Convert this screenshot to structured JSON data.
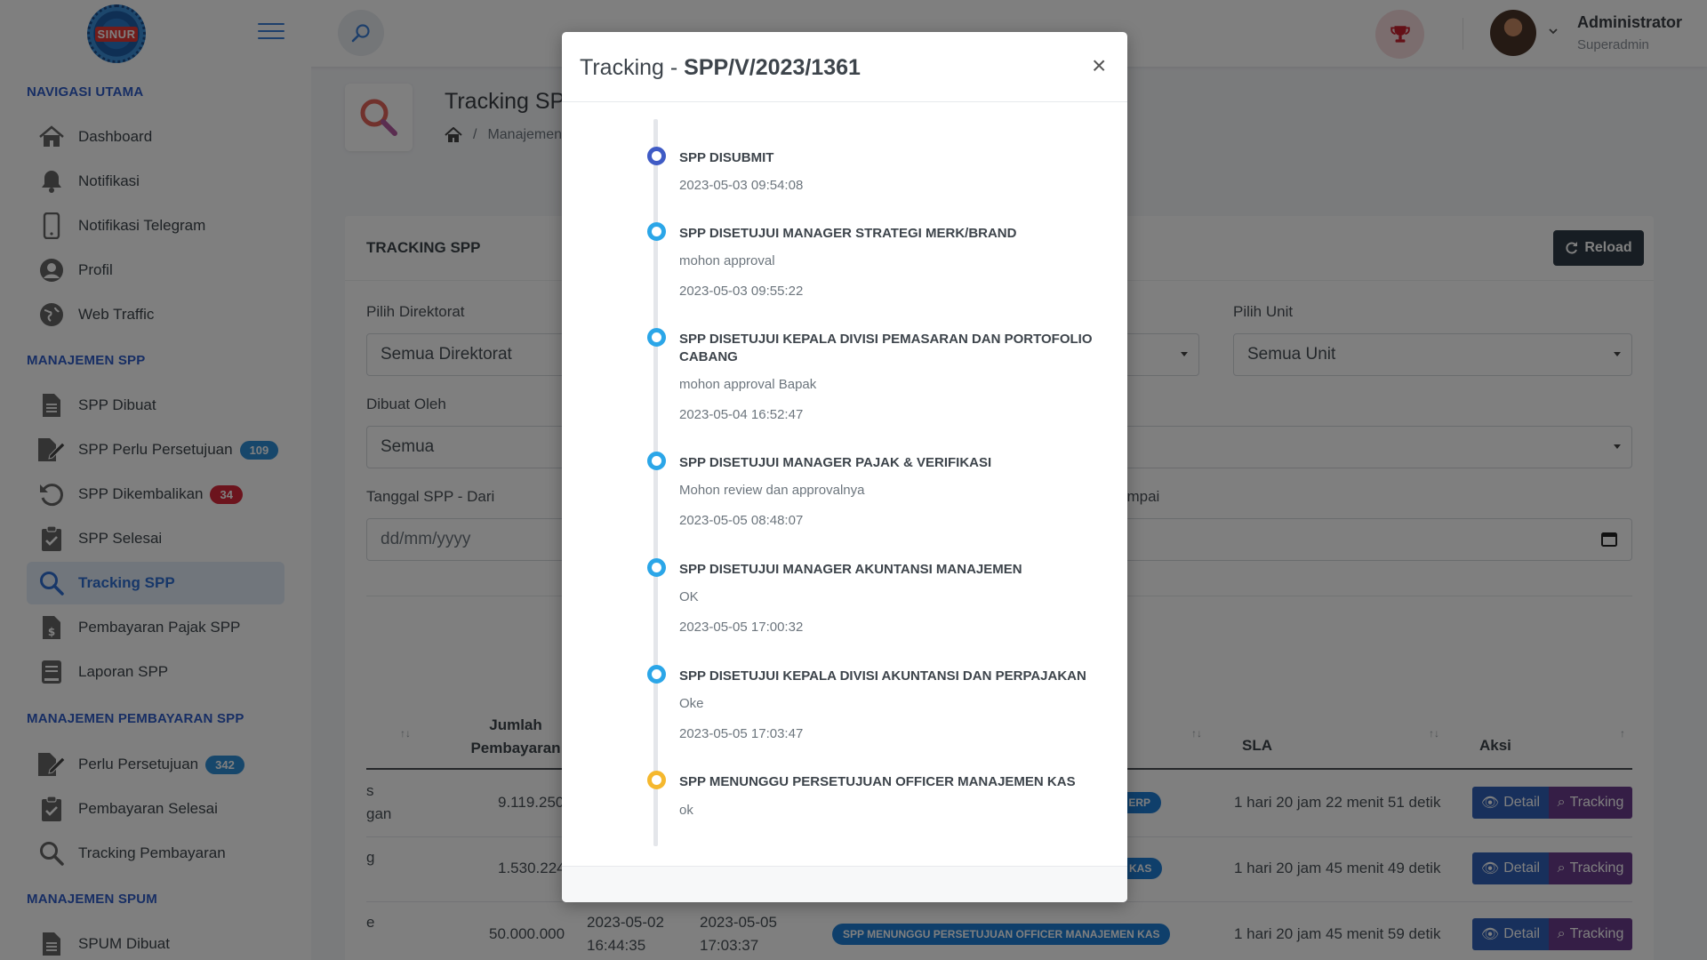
{
  "app": {
    "logo_text": "SINUR"
  },
  "user": {
    "name": "Administrator",
    "role": "Superadmin"
  },
  "sidebar": {
    "sections": [
      {
        "title": "NAVIGASI UTAMA"
      },
      {
        "title": "MANAJEMEN SPP"
      },
      {
        "title": "MANAJEMEN PEMBAYARAN SPP"
      },
      {
        "title": "MANAJEMEN SPUM"
      }
    ],
    "items": [
      {
        "label": "Dashboard",
        "icon": "home-icon"
      },
      {
        "label": "Notifikasi",
        "icon": "bell-icon"
      },
      {
        "label": "Notifikasi Telegram",
        "icon": "mobile-icon"
      },
      {
        "label": "Profil",
        "icon": "user-circle-icon"
      },
      {
        "label": "Web Traffic",
        "icon": "globe-icon"
      },
      {
        "label": "SPP Dibuat",
        "icon": "file-icon"
      },
      {
        "label": "SPP Perlu Persetujuan",
        "icon": "file-signature-icon",
        "badge": "109",
        "badge_color": "#2e8fd6"
      },
      {
        "label": "SPP Dikembalikan",
        "icon": "undo-icon",
        "badge": "34",
        "badge_color": "#d9283a"
      },
      {
        "label": "SPP Selesai",
        "icon": "clipboard-check-icon"
      },
      {
        "label": "Tracking SPP",
        "icon": "search-icon",
        "active": true
      },
      {
        "label": "Pembayaran Pajak SPP",
        "icon": "file-invoice-dollar-icon"
      },
      {
        "label": "Laporan SPP",
        "icon": "book-icon"
      },
      {
        "label": "Perlu Persetujuan",
        "icon": "file-signature-icon",
        "badge": "342",
        "badge_color": "#2e8fd6"
      },
      {
        "label": "Pembayaran Selesai",
        "icon": "clipboard-check-icon"
      },
      {
        "label": "Tracking Pembayaran",
        "icon": "search-icon"
      },
      {
        "label": "SPUM Dibuat",
        "icon": "file-icon"
      }
    ]
  },
  "page": {
    "title": "Tracking SPP",
    "breadcrumb": "Manajemen"
  },
  "card": {
    "title": "TRACKING SPP",
    "reload_label": "Reload",
    "filters": {
      "direktorat_label": "Pilih Direktorat",
      "direktorat_value": "Semua Direktorat",
      "unit_label": "Pilih Unit",
      "unit_value": "Semua Unit",
      "dibuat_oleh_label": "Dibuat Oleh",
      "dibuat_oleh_value": "Semua",
      "tanggal_dari_label": "Tanggal SPP - Dari",
      "tanggal_dari_placeholder": "dd/mm/yyyy",
      "tanggal_sampai_label_fragment": "ampai",
      "tanggal_sampai_fragment": "y"
    },
    "table": {
      "headers": {
        "jumlah_1": "Jumlah",
        "jumlah_2": "Pembayaran",
        "sla": "SLA",
        "aksi": "Aksi"
      },
      "rows": [
        {
          "left_frag_1": "s",
          "left_frag_2": "gan",
          "jumlah": "9.119.250",
          "status_frag": "DAN ERP",
          "sla": "1 hari 20 jam 22 menit 51 detik"
        },
        {
          "left_frag_1": "g",
          "left_frag_2": "",
          "jumlah": "1.530.224",
          "status_frag": "MEN KAS",
          "sla": "1 hari 20 jam 45 menit 49 detik"
        },
        {
          "left_frag_1": "e",
          "left_frag_2": "",
          "jumlah": "50.000.000",
          "tgl1_date": "2023-05-02",
          "tgl1_time": "16:44:35",
          "tgl2_date": "2023-05-05",
          "tgl2_time": "17:03:37",
          "status": "SPP MENUNGGU PERSETUJUAN OFFICER MANAJEMEN KAS",
          "sla": "1 hari 20 jam 45 menit 59 detik"
        }
      ],
      "detail_label": "Detail",
      "tracking_label": "Tracking"
    }
  },
  "modal": {
    "title_prefix": "Tracking - ",
    "title_code": "SPP/V/2023/1361",
    "close_symbol": "×",
    "timeline": [
      {
        "title": "SPP DISUBMIT",
        "note": "",
        "time": "2023-05-03 09:54:08",
        "dot_color": "#3f5bc5"
      },
      {
        "title": "SPP DISETUJUI MANAGER STRATEGI MERK/BRAND",
        "note": "mohon approval",
        "time": "2023-05-03 09:55:22",
        "dot_color": "#2ba6e8"
      },
      {
        "title": "SPP DISETUJUI KEPALA DIVISI PEMASARAN DAN PORTOFOLIO CABANG",
        "note": "mohon approval Bapak",
        "time": "2023-05-04 16:52:47",
        "dot_color": "#2ba6e8"
      },
      {
        "title": "SPP DISETUJUI MANAGER PAJAK & VERIFIKASI",
        "note": "Mohon review dan approvalnya",
        "time": "2023-05-05 08:48:07",
        "dot_color": "#2ba6e8"
      },
      {
        "title": "SPP DISETUJUI MANAGER AKUNTANSI MANAJEMEN",
        "note": "OK",
        "time": "2023-05-05 17:00:32",
        "dot_color": "#2ba6e8"
      },
      {
        "title": "SPP DISETUJUI KEPALA DIVISI AKUNTANSI DAN PERPAJAKAN",
        "note": "Oke",
        "time": "2023-05-05 17:03:47",
        "dot_color": "#2ba6e8"
      },
      {
        "title": "SPP MENUNGGU PERSETUJUAN OFFICER MANAJEMEN KAS",
        "note": "ok",
        "time": "",
        "dot_color": "#f5b82e"
      }
    ]
  }
}
